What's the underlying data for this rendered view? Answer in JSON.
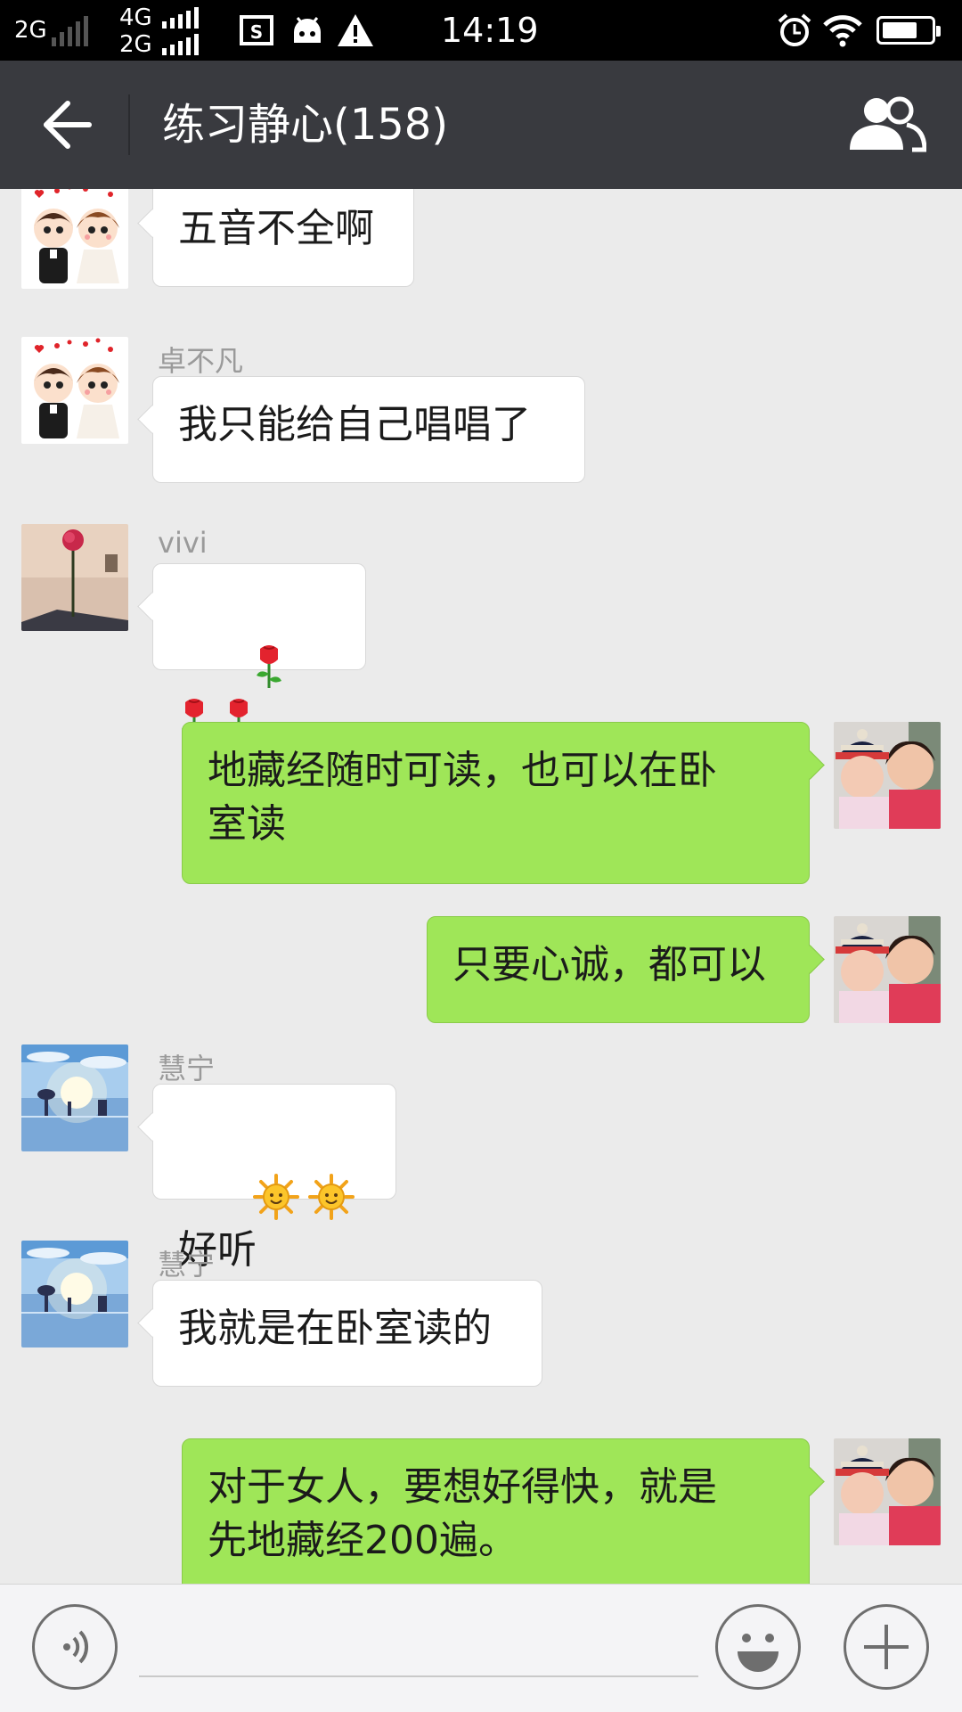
{
  "status_bar": {
    "network_top": "2G",
    "network_mid_top": "4G",
    "network_mid_bottom": "2G",
    "time": "14:19",
    "icons": [
      "screenshot-icon",
      "android-icon",
      "warning-icon",
      "alarm-icon",
      "wifi-icon",
      "battery-icon"
    ]
  },
  "header": {
    "title": "练习静心(158)",
    "back_icon": "arrow-left-icon",
    "group_icon": "group-members-icon"
  },
  "colors": {
    "title_bar": "#393a3f",
    "chat_background": "#ebebeb",
    "outgoing_bubble": "#9fe658",
    "incoming_bubble": "#ffffff"
  },
  "messages": [
    {
      "direction": "in",
      "sender": "",
      "text": "五音不全啊",
      "avatar": "cartoon-couple"
    },
    {
      "direction": "in",
      "sender": "卓不凡",
      "text": "我只能给自己唱唱了",
      "avatar": "cartoon-couple"
    },
    {
      "direction": "in",
      "sender": "vivi",
      "text": "",
      "emoji": [
        "rose",
        "rose",
        "rose"
      ],
      "avatar": "rose-photo"
    },
    {
      "direction": "out",
      "sender": "",
      "text": "地藏经随时可读，也可以在卧\n室读",
      "avatar": "mother-baby-photo"
    },
    {
      "direction": "out",
      "sender": "",
      "text": "只要心诚，都可以",
      "avatar": "mother-baby-photo"
    },
    {
      "direction": "in",
      "sender": "慧宁",
      "text": "好听",
      "emoji": [
        "sun",
        "sun"
      ],
      "avatar": "sunset-lake"
    },
    {
      "direction": "in",
      "sender": "慧宁",
      "text": "我就是在卧室读的",
      "avatar": "sunset-lake"
    },
    {
      "direction": "out",
      "sender": "",
      "text": "对于女人，要想好得快，就是\n先地藏经200遍。",
      "avatar": "mother-baby-photo"
    }
  ],
  "input_bar": {
    "voice_icon": "voice-input-icon",
    "emoji_icon": "smiley-icon",
    "more_icon": "plus-icon",
    "input_value": ""
  }
}
